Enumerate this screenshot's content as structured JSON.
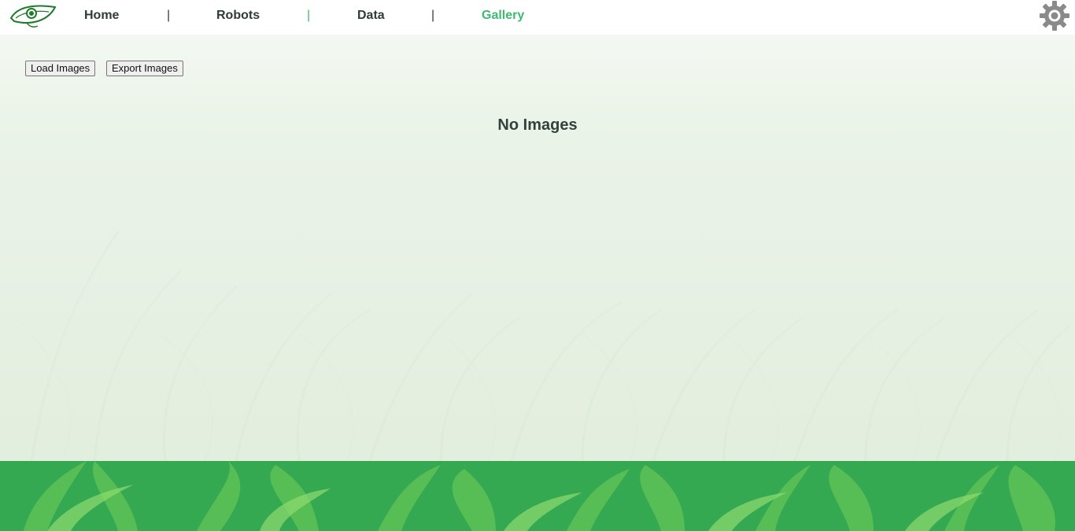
{
  "nav": {
    "links": [
      {
        "label": "Home"
      },
      {
        "label": "Robots"
      },
      {
        "label": "Data"
      },
      {
        "label": "Gallery"
      }
    ],
    "separator": "|",
    "active": "Gallery",
    "logo_icon": "eye-leaf-logo",
    "settings_icon": "gear-icon"
  },
  "toolbar": {
    "load_label": "Load Images",
    "export_label": "Export Images"
  },
  "gallery": {
    "empty_message": "No Images"
  },
  "colors": {
    "accent": "#3dba6f",
    "text": "#2f3b37",
    "footer_green": "#35a852",
    "settings_gray": "#8a8a8a"
  }
}
